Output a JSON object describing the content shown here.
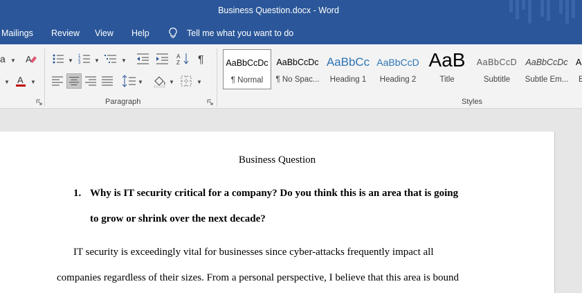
{
  "window": {
    "title": "Business Question.docx  -  Word"
  },
  "menu": {
    "tabs": [
      "Mailings",
      "Review",
      "View",
      "Help"
    ],
    "tell_me": "Tell me what you want to do"
  },
  "ribbon": {
    "paragraph_label": "Paragraph",
    "styles_label": "Styles",
    "font_partial": "a",
    "styles": [
      {
        "sample": "AaBbCcDc",
        "name": "¶ Normal",
        "selected": true
      },
      {
        "sample": "AaBbCcDc",
        "name": "¶ No Spac..."
      },
      {
        "sample": "AaBbCc",
        "name": "Heading 1"
      },
      {
        "sample": "AaBbCcD",
        "name": "Heading 2"
      },
      {
        "sample": "AaB",
        "name": "Title"
      },
      {
        "sample": "AaBbCcD",
        "name": "Subtitle"
      },
      {
        "sample": "AaBbCcDc",
        "name": "Subtle Em..."
      },
      {
        "sample": "A",
        "name": "E"
      }
    ],
    "colors": {
      "accent": "#2b579a",
      "font_color": "#c00000"
    }
  },
  "document": {
    "title": "Business Question",
    "question_number": "1.",
    "question_lines": [
      "Why is IT security critical for a company? Do you think this is an area that is going",
      "to grow or shrink over the next decade?"
    ],
    "paragraph_lines": [
      "IT security is exceedingly vital for businesses since cyber-attacks frequently impact all",
      "companies regardless of their sizes. From a personal perspective, I believe that this area is bound"
    ]
  }
}
